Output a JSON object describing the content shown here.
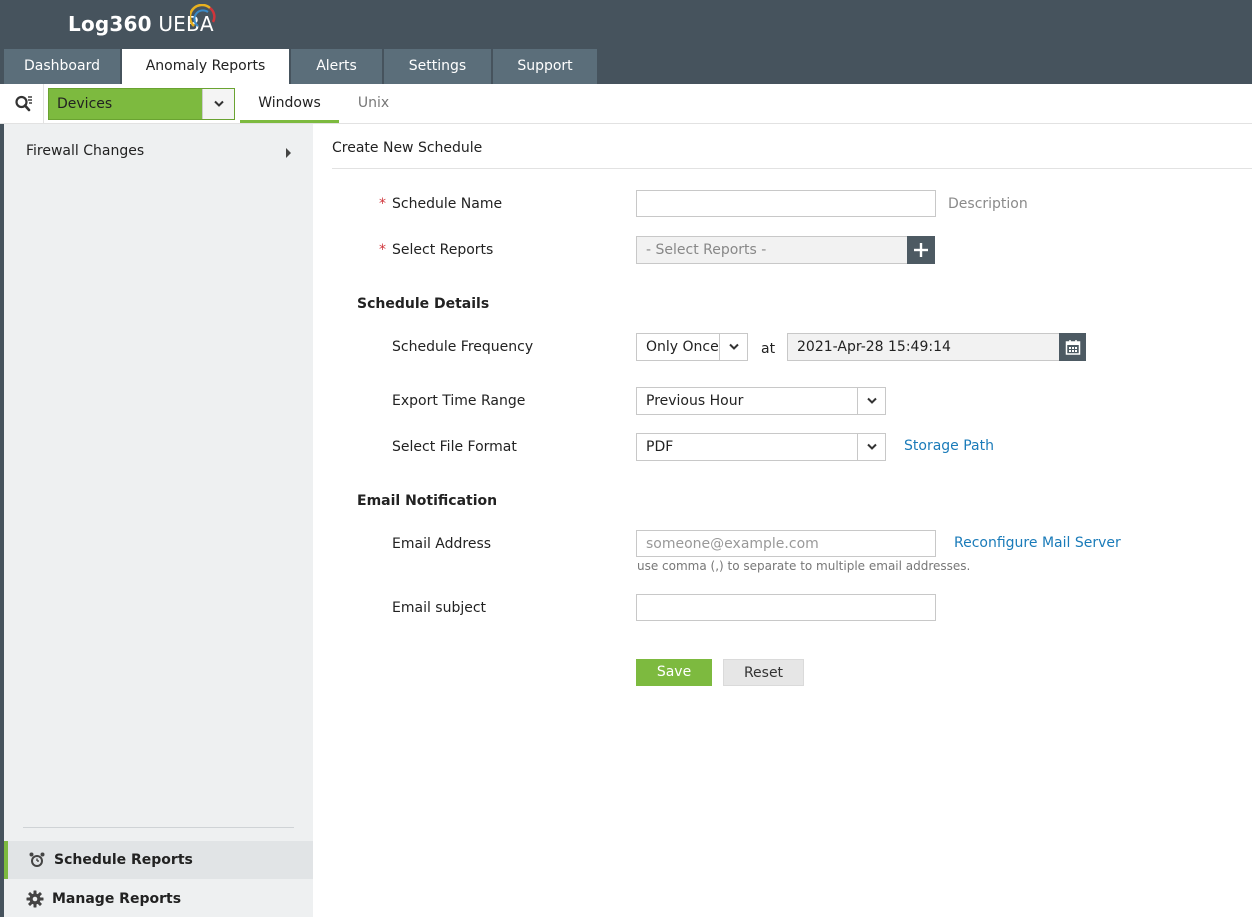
{
  "app": {
    "brand": "Log360",
    "product": "UEBA"
  },
  "nav": {
    "tabs": [
      {
        "label": "Dashboard"
      },
      {
        "label": "Anomaly Reports"
      },
      {
        "label": "Alerts"
      },
      {
        "label": "Settings"
      },
      {
        "label": "Support"
      }
    ],
    "active": "Anomaly Reports"
  },
  "subbar": {
    "device_select": "Devices",
    "tabs": [
      {
        "label": "Windows"
      },
      {
        "label": "Unix"
      }
    ],
    "active": "Windows"
  },
  "sidebar": {
    "items": [
      {
        "label": "Firewall Changes"
      }
    ],
    "bottom": [
      {
        "label": "Schedule Reports"
      },
      {
        "label": "Manage Reports"
      }
    ],
    "selected": "Schedule Reports"
  },
  "form": {
    "title": "Create New Schedule",
    "required_mark": "*",
    "schedule_name": {
      "label": "Schedule Name",
      "value": "",
      "description_link": "Description"
    },
    "select_reports": {
      "label": "Select Reports",
      "placeholder": "- Select Reports -"
    },
    "schedule_details": {
      "heading": "Schedule Details",
      "frequency": {
        "label": "Schedule Frequency",
        "value": "Only Once",
        "at_label": "at",
        "datetime": "2021-Apr-28 15:49:14"
      },
      "export_range": {
        "label": "Export Time Range",
        "value": "Previous Hour"
      },
      "file_format": {
        "label": "Select File Format",
        "value": "PDF",
        "storage_link": "Storage Path"
      }
    },
    "email": {
      "heading": "Email Notification",
      "address": {
        "label": "Email Address",
        "placeholder": "someone@example.com",
        "reconfigure_link": "Reconfigure Mail Server",
        "hint": "use comma (,) to separate to multiple email addresses."
      },
      "subject": {
        "label": "Email subject",
        "value": ""
      }
    },
    "buttons": {
      "save": "Save",
      "reset": "Reset"
    }
  },
  "colors": {
    "header": "#46535d",
    "tab": "#5b6e7a",
    "accent": "#7dba3f",
    "link": "#1a7bb9",
    "required": "#d0353b",
    "sidebar": "#eef0f1"
  }
}
